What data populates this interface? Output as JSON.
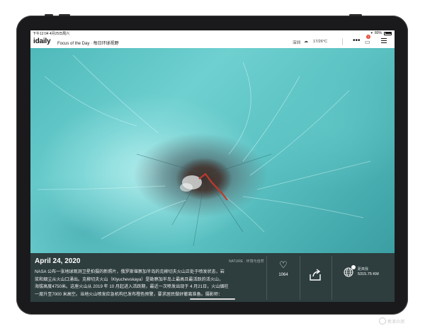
{
  "status_bar": {
    "time_date": "下午12:04  4月25日周六",
    "battery": "80%"
  },
  "app": {
    "logo": "idaily",
    "subtitle": "Focus of the Day · 每日环球视野",
    "weather_city": "深圳",
    "weather_icon": "cloud-icon",
    "weather_temp": "17/26°C",
    "notification_count": "1"
  },
  "story": {
    "date": "April 24, 2020",
    "category": "NATURE · 环境与自然",
    "body_lines": [
      "NASA 公布一张地球观测卫星拍摄的新照片，俄罗斯堪察加半岛的克柳切夫火山正处于喷发状态，岩",
      "浆和烟尘从火山口涌出。克柳切夫火山（Klyuchevskaya）是勘察加半岛上最高且最活跃的活火山，",
      "海拔高度4750米。这座火山从 2019 年 10 月起进入活跃期，最近一次喷发出现于 4 月21日，火山烟柱",
      "一度升至7000 米高空。当地火山喷发应急机构已发布橙色预警，要求居民做好撤离准备。摄影师："
    ],
    "likes": "1064",
    "distance_label": "距离我",
    "distance_value": "5315.75 KM"
  },
  "watermark": "新浪众测"
}
